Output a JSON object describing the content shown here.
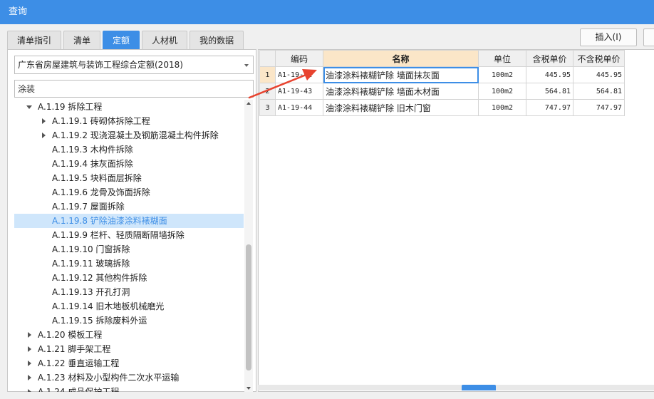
{
  "window": {
    "title": "查询"
  },
  "tabs": [
    {
      "label": "清单指引",
      "active": false
    },
    {
      "label": "清单",
      "active": false
    },
    {
      "label": "定额",
      "active": true
    },
    {
      "label": "人材机",
      "active": false
    },
    {
      "label": "我的数据",
      "active": false
    }
  ],
  "toolbar": {
    "insert_label": "插入(I)"
  },
  "library_select": {
    "value": "广东省房屋建筑与装饰工程综合定额(2018)"
  },
  "search": {
    "value": "涂装"
  },
  "tree": [
    {
      "label": "A.1.19 拆除工程",
      "level": 1,
      "state": "expanded",
      "selected": false
    },
    {
      "label": "A.1.19.1 砖砌体拆除工程",
      "level": 2,
      "state": "collapsed",
      "selected": false
    },
    {
      "label": "A.1.19.2 现浇混凝土及钢筋混凝土构件拆除",
      "level": 2,
      "state": "collapsed",
      "selected": false
    },
    {
      "label": "A.1.19.3 木构件拆除",
      "level": 2,
      "state": "leaf",
      "selected": false
    },
    {
      "label": "A.1.19.4 抹灰面拆除",
      "level": 2,
      "state": "leaf",
      "selected": false
    },
    {
      "label": "A.1.19.5 块料面层拆除",
      "level": 2,
      "state": "leaf",
      "selected": false
    },
    {
      "label": "A.1.19.6 龙骨及饰面拆除",
      "level": 2,
      "state": "leaf",
      "selected": false
    },
    {
      "label": "A.1.19.7 屋面拆除",
      "level": 2,
      "state": "leaf",
      "selected": false
    },
    {
      "label": "A.1.19.8 铲除油漆涂料裱糊面",
      "level": 2,
      "state": "leaf",
      "selected": true
    },
    {
      "label": "A.1.19.9 栏杆、轻质隔断隔墙拆除",
      "level": 2,
      "state": "leaf",
      "selected": false
    },
    {
      "label": "A.1.19.10 门窗拆除",
      "level": 2,
      "state": "leaf",
      "selected": false
    },
    {
      "label": "A.1.19.11 玻璃拆除",
      "level": 2,
      "state": "leaf",
      "selected": false
    },
    {
      "label": "A.1.19.12 其他构件拆除",
      "level": 2,
      "state": "leaf",
      "selected": false
    },
    {
      "label": "A.1.19.13 开孔打洞",
      "level": 2,
      "state": "leaf",
      "selected": false
    },
    {
      "label": "A.1.19.14 旧木地板机械磨光",
      "level": 2,
      "state": "leaf",
      "selected": false
    },
    {
      "label": "A.1.19.15 拆除废料外运",
      "level": 2,
      "state": "leaf",
      "selected": false
    },
    {
      "label": "A.1.20 模板工程",
      "level": 1,
      "state": "collapsed",
      "selected": false
    },
    {
      "label": "A.1.21 脚手架工程",
      "level": 1,
      "state": "collapsed",
      "selected": false
    },
    {
      "label": "A.1.22 垂直运输工程",
      "level": 1,
      "state": "collapsed",
      "selected": false
    },
    {
      "label": "A.1.23 材料及小型构件二次水平运输",
      "level": 1,
      "state": "collapsed",
      "selected": false
    },
    {
      "label": "A.1.24 成品保护工程",
      "level": 1,
      "state": "collapsed",
      "selected": false
    }
  ],
  "grid": {
    "columns": [
      "编码",
      "名称",
      "单位",
      "含税单价",
      "不含税单价"
    ],
    "rows": [
      {
        "index": "1",
        "code": "A1-19-42",
        "name": "油漆涂料裱糊铲除 墙面抹灰面",
        "unit": "100m2",
        "price_tax": "445.95",
        "price_notax": "445.95"
      },
      {
        "index": "2",
        "code": "A1-19-43",
        "name": "油漆涂料裱糊铲除 墙面木材面",
        "unit": "100m2",
        "price_tax": "564.81",
        "price_notax": "564.81"
      },
      {
        "index": "3",
        "code": "A1-19-44",
        "name": "油漆涂料裱糊铲除 旧木门窗",
        "unit": "100m2",
        "price_tax": "747.97",
        "price_notax": "747.97"
      }
    ]
  },
  "colors": {
    "accent": "#3d8ee6",
    "header_highlight": "#fbe6c8",
    "selection": "#cfe6fb",
    "annotation": "#e8432f"
  }
}
